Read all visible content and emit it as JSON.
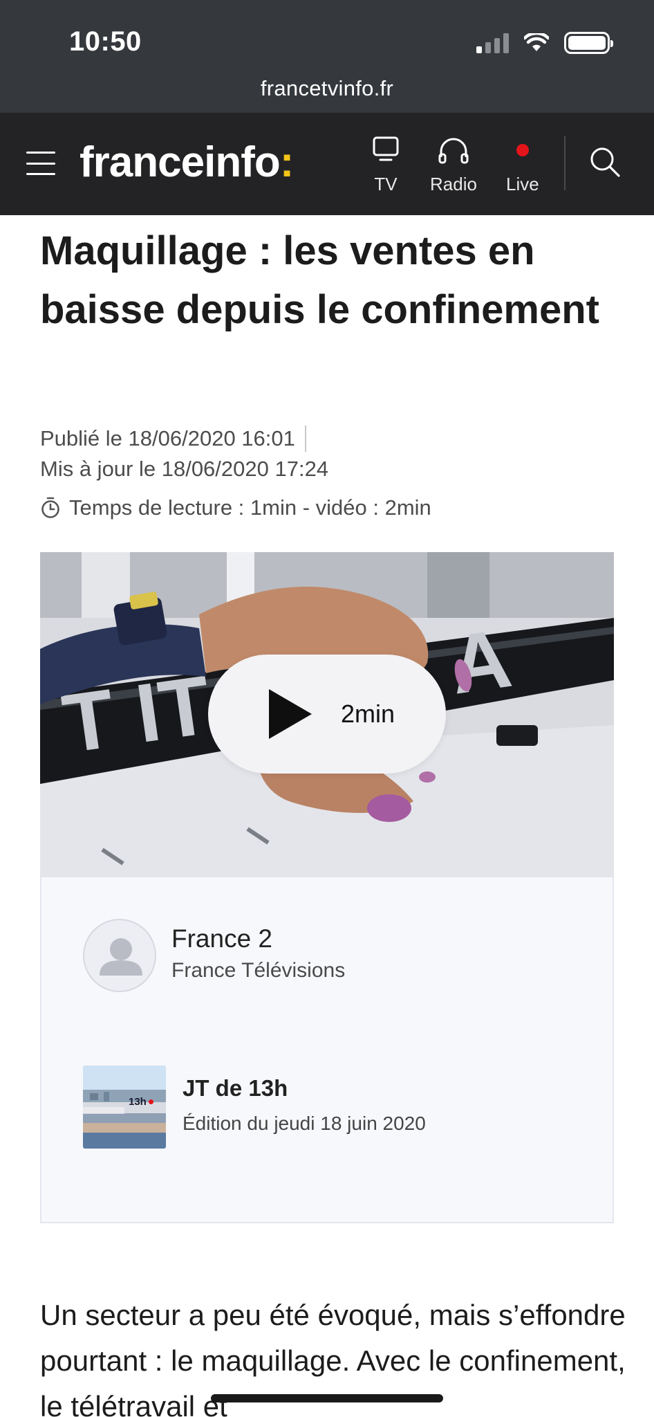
{
  "status": {
    "time": "10:50",
    "url": "francetvinfo.fr"
  },
  "header": {
    "logo_text": "franceinfo",
    "logo_colon": ":",
    "nav": [
      {
        "label": "TV",
        "icon": "tv-icon"
      },
      {
        "label": "Radio",
        "icon": "headphones-icon"
      },
      {
        "label": "Live",
        "icon": "live-dot-icon"
      }
    ],
    "accent_color": "#f5c518",
    "live_color": "#e4141b"
  },
  "article": {
    "title": "Maquillage : les ventes en baisse depuis le confinement",
    "published": "Publié le 18/06/2020 16:01",
    "updated": "Mis à jour le 18/06/2020 17:24",
    "reading_time": "Temps de lecture : 1min - vidéo : 2min",
    "body": "Un secteur a peu été évoqué, mais s’effondre pourtant : le maquillage. Avec le confinement, le télétravail et"
  },
  "video": {
    "duration": "2min"
  },
  "source": {
    "channel": "France 2",
    "organization": "France Télévisions",
    "show_title": "JT de 13h",
    "show_date": "Édition du jeudi 18 juin 2020",
    "thumb_badge": "13h"
  }
}
